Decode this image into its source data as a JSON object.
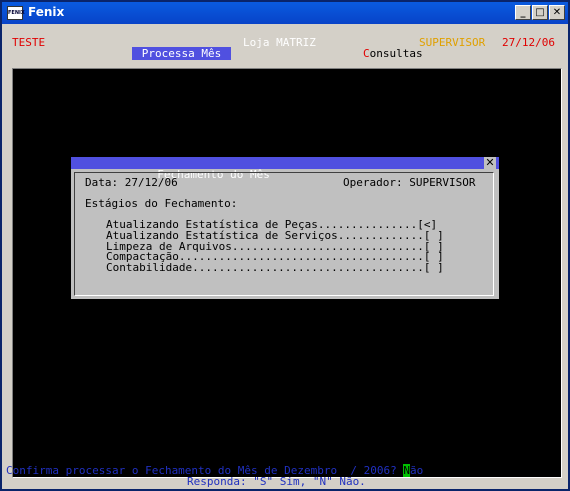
{
  "window": {
    "title": "Fenix",
    "icon": "fenix-app-icon",
    "icon_text": "FENIX",
    "min_glyph": "_",
    "max_glyph": "□",
    "close_glyph": "✕"
  },
  "header": {
    "company": "TESTE",
    "store": "Loja MATRIZ",
    "user": "SUPERVISOR",
    "date": "27/12/06",
    "menu_active": "Processa Mês",
    "menu_other_hotkey": "C",
    "menu_other_rest": "onsultas"
  },
  "dialog": {
    "title": "Fechamento do Mês",
    "close_glyph": "✕",
    "date_line": "Data: 27/12/06",
    "operator_line": "Operador: SUPERVISOR",
    "stages_heading": "Estágios do Fechamento:",
    "stages": [
      "Atualizando Estatística de Peças...............[<]",
      "Atualizando Estatística de Serviços.............[ ]",
      "Limpeza de Arquivos.............................[ ]",
      "Compactação.....................................[ ]",
      "Contabilidade...................................[ ]"
    ]
  },
  "status": {
    "prompt": "Confirma processar o Fechamento do Mês de Dezembro  / 2006? ",
    "answer_hotkey": "N",
    "answer_rest": "ão",
    "hint": "Responda: \"S\" Sim, \"N\" Não."
  },
  "colors": {
    "red": "#e00000",
    "orange": "#e0a000",
    "blue_status": "#2030c0",
    "menu_highlight": "#5050e0"
  }
}
